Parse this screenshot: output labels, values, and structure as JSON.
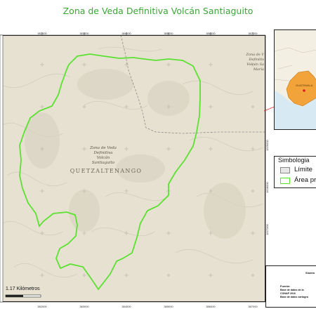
{
  "title": "Zona de Veda Definitiva Volcán Santiaguito",
  "map": {
    "region_label": "QUETZALTENANGO",
    "zone_label_lines": [
      "Zona de Veda",
      "Definitiva",
      "Volcán",
      "Santiaguito"
    ],
    "corner_label_lines": [
      "Zona de V",
      "Definitiv",
      "Volcán Sa",
      "María"
    ],
    "scale_label": "1.17 Kilómetros",
    "boundary_color": "#5ce132",
    "terrain_color": "#e6e1d1",
    "road_color": "#8c8c8c",
    "x_ticks_top": [
      "382000",
      "383000",
      "384000",
      "385000",
      "386000",
      "387000"
    ],
    "x_ticks_bottom": [
      "382000",
      "383000",
      "384000",
      "385000",
      "386000",
      "387000"
    ],
    "y_ticks_right": [
      "1629000",
      "1628000",
      "1627000"
    ]
  },
  "inset": {
    "country_label": "GUATEMALA",
    "highlight_color": "#f2a33a",
    "water_color": "#d7eaf3"
  },
  "legend": {
    "title": "Simbologia",
    "items": [
      {
        "label": "Límite",
        "swatch_fill": "#e6e6e6",
        "swatch_border": "#888888"
      },
      {
        "label": "Área pr",
        "swatch_fill": "#ffffff",
        "swatch_border": "#5ce132"
      }
    ]
  },
  "info": {
    "system_label": "Sistem",
    "source_heading": "Fuente:",
    "source_lines": [
      "Base de datos de la",
      "CONAP 2016",
      "Base de datos cartogra"
    ]
  }
}
